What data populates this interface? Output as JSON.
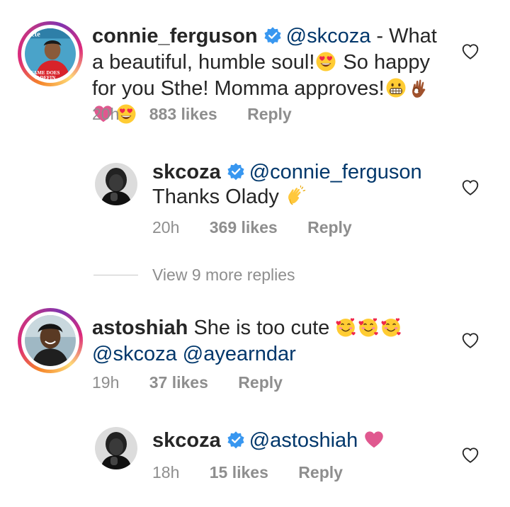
{
  "comments": [
    {
      "username": "connie_ferguson",
      "verified": true,
      "mention": "@skcoza",
      "text_parts": [
        " - What a beautiful, humble soul!",
        " So happy for you Sthe! Momma approves!"
      ],
      "time": "20h",
      "likes": "883 likes",
      "reply_label": "Reply",
      "avatar_caption": "FAME DOES N DEFIN"
    },
    {
      "username": "skcoza",
      "verified": true,
      "mention": "@connie_ferguson",
      "text": "Thanks Olady",
      "time": "20h",
      "likes": "369 likes",
      "reply_label": "Reply"
    },
    {
      "username": "astoshiah",
      "verified": false,
      "text": "She is too cute",
      "mentions": [
        "@skcoza",
        "@ayearndar"
      ],
      "time": "19h",
      "likes": "37 likes",
      "reply_label": "Reply"
    },
    {
      "username": "skcoza",
      "verified": true,
      "mention": "@astoshiah",
      "time": "18h",
      "likes": "15 likes",
      "reply_label": "Reply"
    }
  ],
  "view_more": "View 9 more replies",
  "icons": {
    "verified": "verified-badge-icon",
    "like": "heart-outline-icon",
    "emoji_heart_eyes": "heart-eyes-emoji",
    "emoji_grimace": "grimacing-emoji",
    "emoji_ok": "ok-hand-emoji",
    "emoji_heart": "pink-heart-emoji",
    "emoji_clap": "waving-hands-emoji",
    "emoji_hearts_face": "smiling-face-with-hearts-emoji"
  },
  "colors": {
    "text": "#262626",
    "mention": "#00376b",
    "meta": "#8e8e8e",
    "verified": "#3897f0",
    "pink_heart": "#e0588f"
  }
}
